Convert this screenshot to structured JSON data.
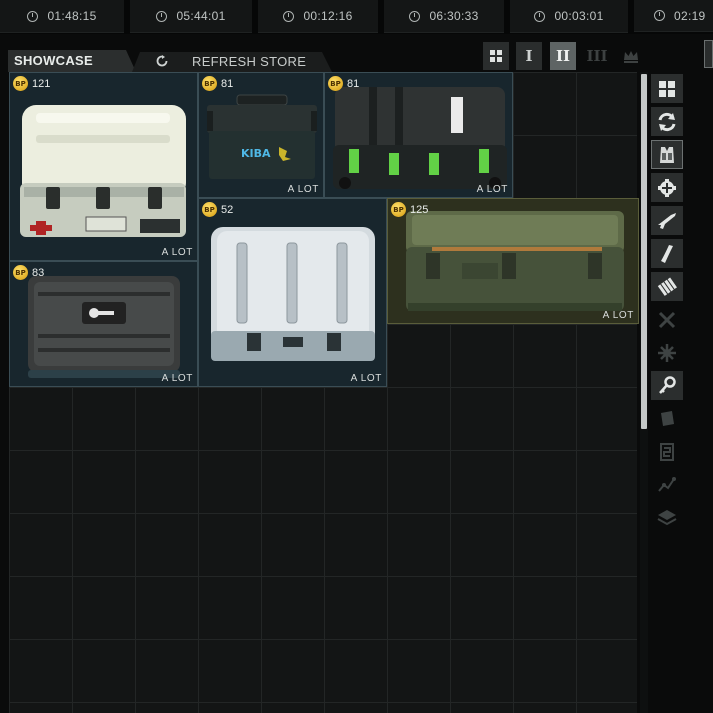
{
  "timers": [
    "01:48:15",
    "05:44:01",
    "00:12:16",
    "06:30:33",
    "00:03:01",
    "02:19"
  ],
  "tabs": {
    "showcase": "SHOWCASE",
    "refresh": "REFRESH STORE"
  },
  "view_buttons": {
    "one": "I",
    "two": "II",
    "three": "III"
  },
  "currency_icon": "BP",
  "items": [
    {
      "price": "121",
      "qty": "A LOT",
      "name": "medical-case"
    },
    {
      "price": "81",
      "qty": "A LOT",
      "name": "ammo-case"
    },
    {
      "price": "81",
      "qty": "A LOT",
      "name": "weapon-case"
    },
    {
      "price": "52",
      "qty": "A LOT",
      "name": "white-container"
    },
    {
      "price": "125",
      "qty": "A LOT",
      "name": "military-crate"
    },
    {
      "price": "83",
      "qty": "A LOT",
      "name": "key-case"
    }
  ],
  "filters": [
    "grid-icon",
    "refresh-icon",
    "gear-vest-icon",
    "medical-icon",
    "rifle-icon",
    "magazine-icon",
    "ammo-icon",
    "melee-icon",
    "barter-icon",
    "keys-icon",
    "info-icon",
    "money-icon",
    "map-icon",
    "layers-icon"
  ],
  "colors": {
    "accent": "#f0b823",
    "selected": "#2d301e",
    "item_bg": "#18262d"
  }
}
